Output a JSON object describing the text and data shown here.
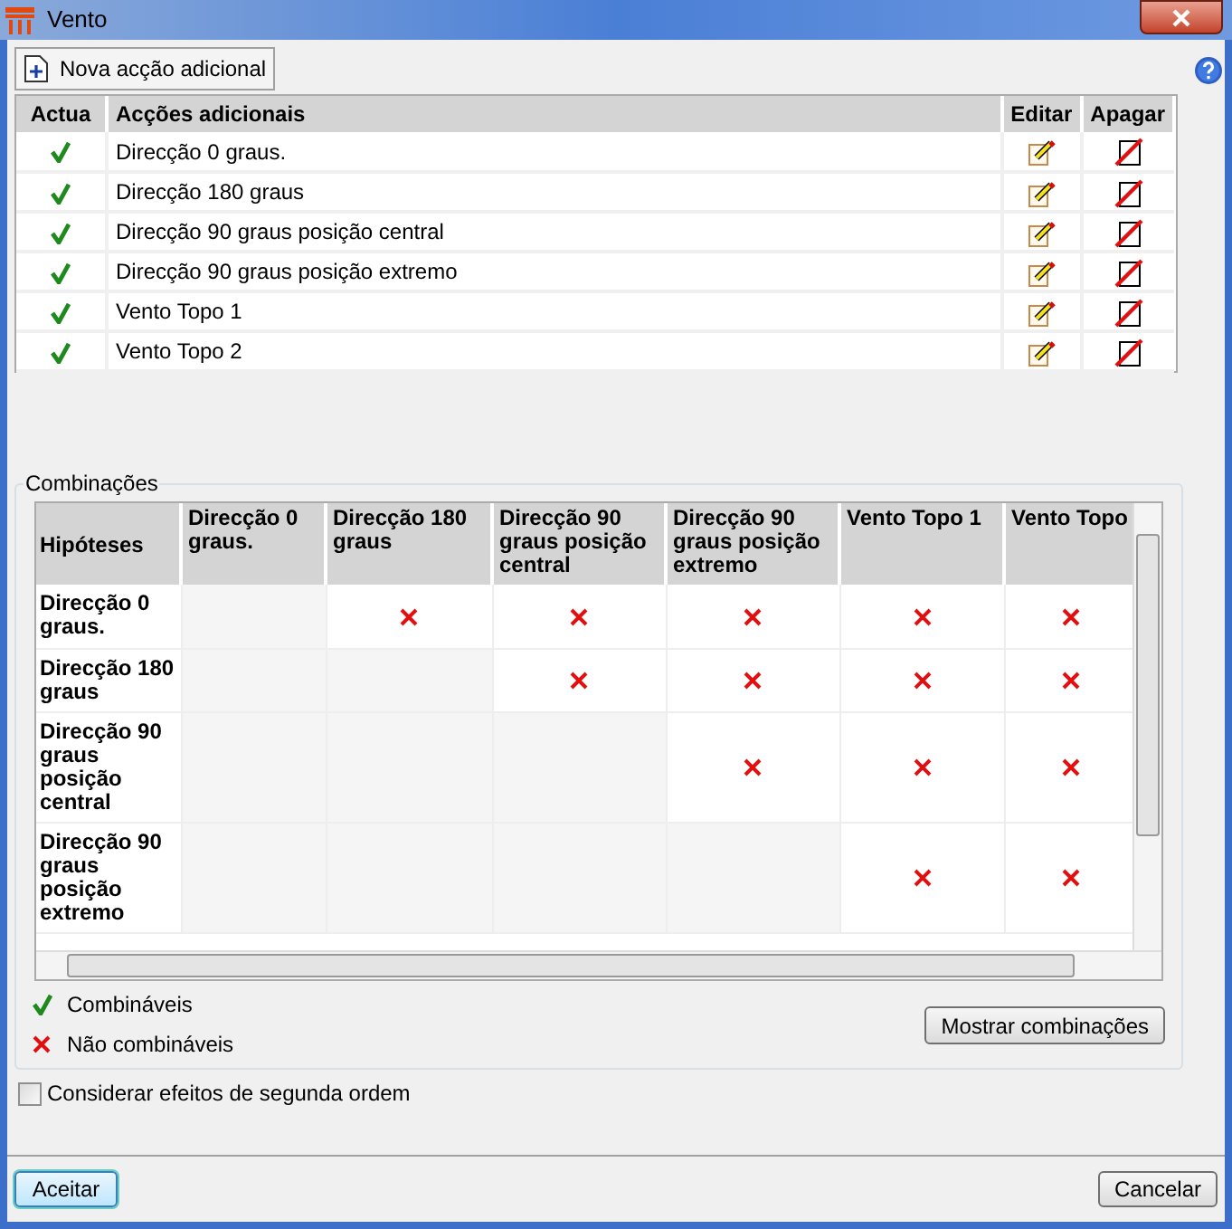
{
  "window": {
    "title": "Vento"
  },
  "toolbar": {
    "new_action_button": "Nova acção adicional"
  },
  "actions_table": {
    "columns": [
      "Actua",
      "Acções adicionais",
      "Editar",
      "Apagar"
    ],
    "rows": [
      {
        "active": true,
        "name": "Direcção 0 graus."
      },
      {
        "active": true,
        "name": "Direcção 180 graus"
      },
      {
        "active": true,
        "name": "Direcção 90 graus posição central"
      },
      {
        "active": true,
        "name": "Direcção 90 graus posição extremo"
      },
      {
        "active": true,
        "name": "Vento Topo 1"
      },
      {
        "active": true,
        "name": "Vento Topo 2"
      }
    ]
  },
  "combinations": {
    "title": "Combinações",
    "corner": "Hipóteses",
    "columns": [
      "Direcção 0 graus.",
      "Direcção 180 graus",
      "Direcção 90 graus posição central",
      "Direcção 90 graus posição extremo",
      "Vento Topo 1",
      "Vento Topo"
    ],
    "rows": [
      {
        "label": "Direcção 0 graus.",
        "cells": [
          {
            "disabled": true
          },
          {
            "disabled": false,
            "incompatible": true
          },
          {
            "disabled": false,
            "incompatible": true
          },
          {
            "disabled": false,
            "incompatible": true
          },
          {
            "disabled": false,
            "incompatible": true
          },
          {
            "disabled": false,
            "incompatible": true
          }
        ]
      },
      {
        "label": "Direcção 180 graus",
        "cells": [
          {
            "disabled": true
          },
          {
            "disabled": true
          },
          {
            "disabled": false,
            "incompatible": true
          },
          {
            "disabled": false,
            "incompatible": true
          },
          {
            "disabled": false,
            "incompatible": true
          },
          {
            "disabled": false,
            "incompatible": true
          }
        ]
      },
      {
        "label": "Direcção 90 graus posição central",
        "cells": [
          {
            "disabled": true
          },
          {
            "disabled": true
          },
          {
            "disabled": true
          },
          {
            "disabled": false,
            "incompatible": true
          },
          {
            "disabled": false,
            "incompatible": true
          },
          {
            "disabled": false,
            "incompatible": true
          }
        ]
      },
      {
        "label": "Direcção 90 graus posição extremo",
        "cells": [
          {
            "disabled": true
          },
          {
            "disabled": true
          },
          {
            "disabled": true
          },
          {
            "disabled": true
          },
          {
            "disabled": false,
            "incompatible": true
          },
          {
            "disabled": false,
            "incompatible": true
          }
        ]
      }
    ],
    "legend": [
      {
        "kind": "compatible",
        "label": "Combináveis"
      },
      {
        "kind": "incompatible",
        "label": "Não combináveis"
      }
    ],
    "show_button": "Mostrar combinações"
  },
  "second_order": {
    "label": "Considerar efeitos de segunda ordem",
    "checked": false
  },
  "buttons": {
    "ok": "Aceitar",
    "cancel": "Cancelar"
  }
}
